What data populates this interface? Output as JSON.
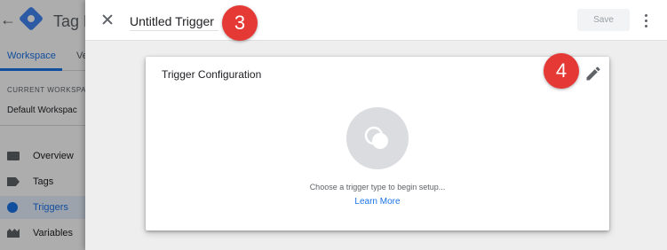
{
  "background_app": {
    "product_name": "Tag M",
    "tabs": [
      {
        "label": "Workspace",
        "active": true
      },
      {
        "label": "Ve",
        "active": false
      }
    ],
    "current_workspace_label": "CURRENT WORKSPACE",
    "current_workspace_value": "Default Workspac",
    "nav_items": [
      {
        "label": "Overview",
        "icon": "folder-icon",
        "active": false
      },
      {
        "label": "Tags",
        "icon": "tag-icon",
        "active": false
      },
      {
        "label": "Triggers",
        "icon": "trigger-icon",
        "active": true
      },
      {
        "label": "Variables",
        "icon": "variables-icon",
        "active": false
      }
    ]
  },
  "panel": {
    "trigger_name": "Untitled Trigger",
    "save_label": "Save"
  },
  "card": {
    "title": "Trigger Configuration",
    "empty_text": "Choose a trigger type to begin setup...",
    "learn_more": "Learn More"
  },
  "annotations": {
    "step_3": "3",
    "step_4": "4"
  },
  "colors": {
    "accent": "#1a73e8",
    "badge": "#e53935",
    "panel_bg": "#eeeeee"
  }
}
